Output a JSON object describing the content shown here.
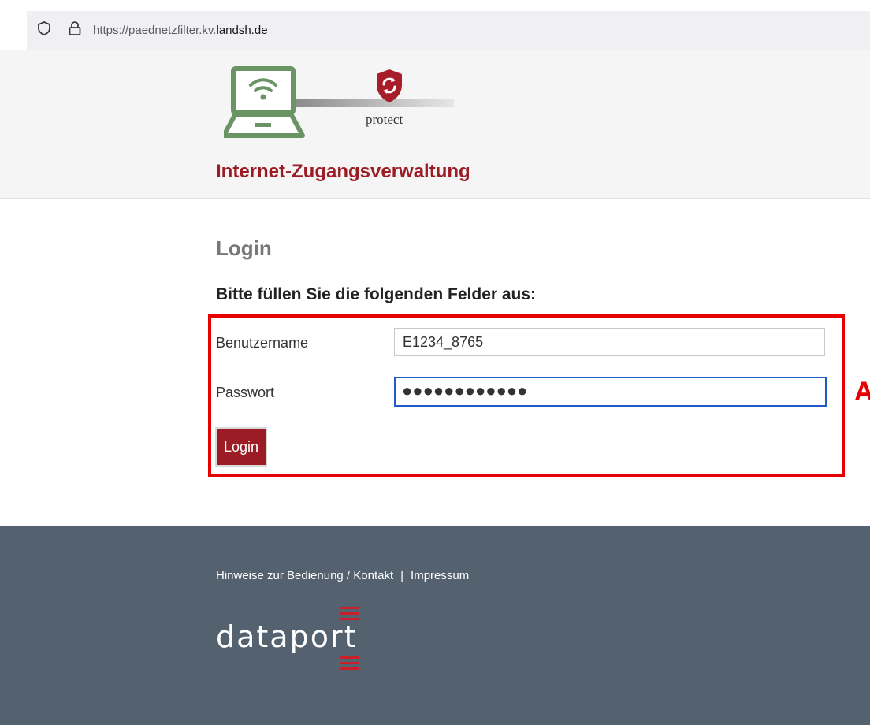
{
  "browser": {
    "url_prefix": "https://paednetzfilter.kv.",
    "url_domain": "landsh.de",
    "icons": [
      "shield-icon",
      "lock-icon"
    ]
  },
  "header": {
    "logo_caption": "protect",
    "title": "Internet-Zugangsverwaltung"
  },
  "main": {
    "heading": "Login",
    "instructions": "Bitte füllen Sie die folgenden Felder aus:",
    "username_label": "Benutzername",
    "username_value": "E1234_8765",
    "password_label": "Passwort",
    "password_masked": "●●●●●●●●●●●●",
    "login_button": "Login",
    "annotation_letter": "A"
  },
  "footer": {
    "link_help": "Hinweise zur Bedienung / Kontakt",
    "separator": "|",
    "link_imprint": "Impressum",
    "brand": "dataport"
  },
  "colors": {
    "brand_red": "#9b1c25",
    "highlight_red": "#e60000",
    "logo_green": "#5f8a5a",
    "footer_bg": "#54626f",
    "focus_blue": "#1f5bc4"
  }
}
